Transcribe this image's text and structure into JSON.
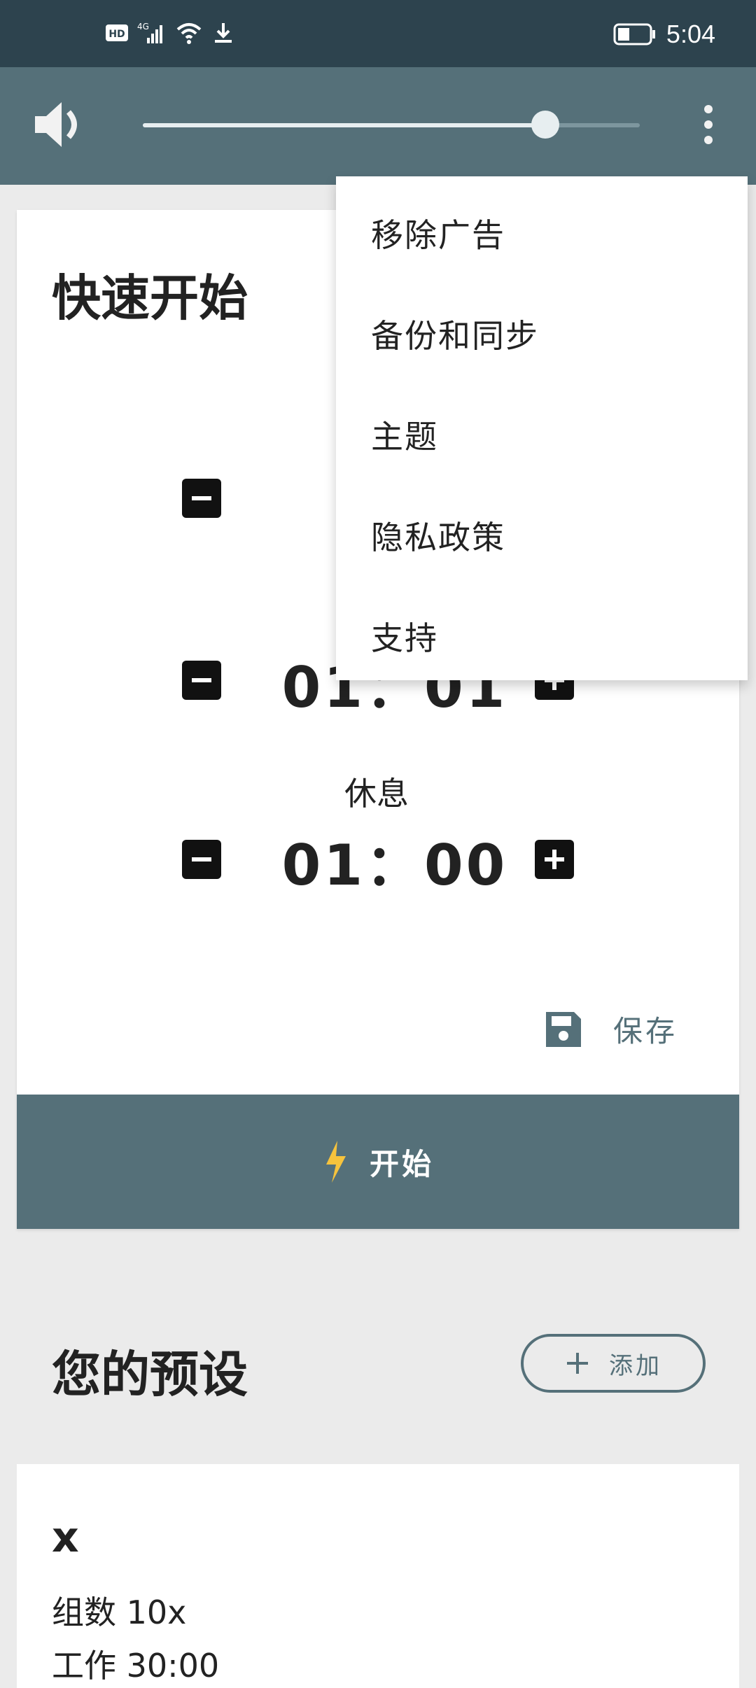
{
  "status": {
    "left_icons": [
      "hd-icon",
      "signal-4g-icon",
      "wifi-icon",
      "download-icon"
    ],
    "time": "5:04"
  },
  "toolbar": {
    "volume_level": 0.81
  },
  "quick_start": {
    "title": "快速开始",
    "rows": [
      {
        "label": "",
        "time": ""
      },
      {
        "label": "",
        "time": "01：01"
      },
      {
        "label": "休息",
        "time": "01：00"
      }
    ],
    "save_label": "保存",
    "start_label": "开始"
  },
  "presets": {
    "title": "您的预设",
    "add_label": "添加",
    "items": [
      {
        "name": "x",
        "sets_label": "组数",
        "sets_value": "10x",
        "work_label": "工作",
        "work_value": "30:00"
      }
    ]
  },
  "menu": {
    "items": [
      "移除广告",
      "备份和同步",
      "主题",
      "隐私政策",
      "支持"
    ]
  },
  "colors": {
    "primary": "#557079",
    "status_bar": "#2d434e",
    "background": "#ebebeb",
    "accent": "#f6c33d"
  }
}
